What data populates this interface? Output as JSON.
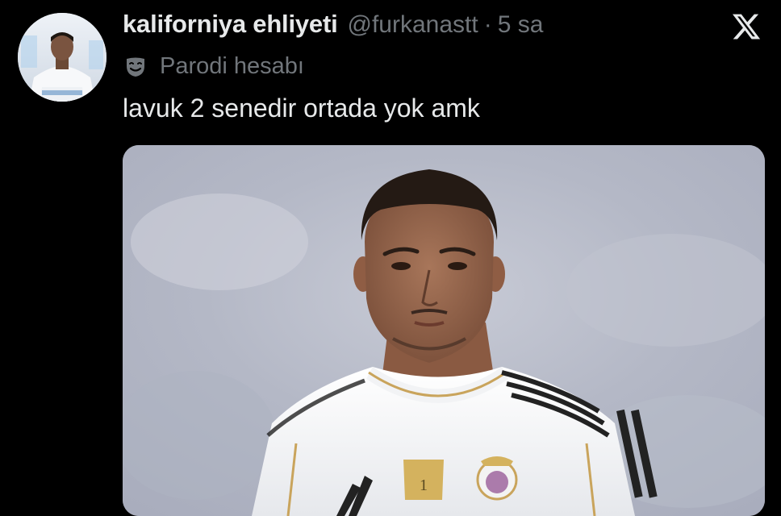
{
  "tweet": {
    "display_name": "kaliforniya ehliyeti",
    "handle": "@furkanastt",
    "separator": "·",
    "time": "5 sa",
    "parody_label": "Parodi hesabı",
    "text": "lavuk 2 senedir ortada yok amk"
  },
  "icons": {
    "avatar": "avatar",
    "parody": "theater-mask-icon",
    "brand": "x-logo-icon",
    "media": "tweet-photo"
  },
  "colors": {
    "background": "#000000",
    "primary_text": "#e7e9ea",
    "secondary_text": "#71767b"
  }
}
